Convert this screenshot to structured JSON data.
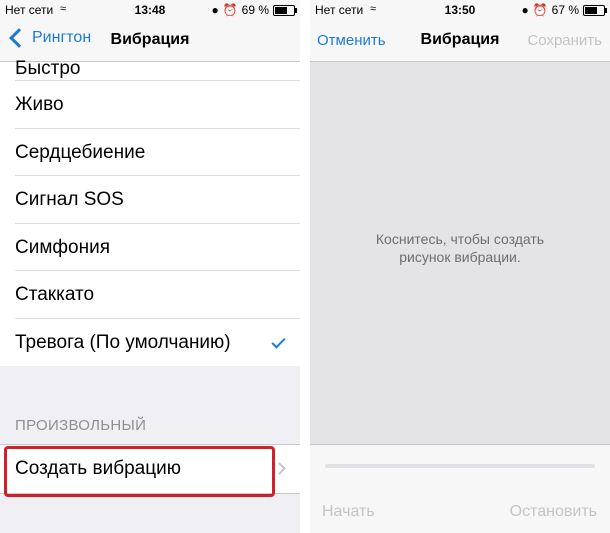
{
  "left_screen": {
    "status": {
      "carrier": "Нет сети",
      "time": "13:48",
      "battery": "69 %",
      "battery_level": 0.69
    },
    "nav": {
      "back_label": "Рингтон",
      "title": "Вибрация"
    },
    "items": [
      {
        "label": "Быстро",
        "checked": false
      },
      {
        "label": "Живо",
        "checked": false
      },
      {
        "label": "Сердцебиение",
        "checked": false
      },
      {
        "label": "Сигнал SOS",
        "checked": false
      },
      {
        "label": "Симфония",
        "checked": false
      },
      {
        "label": "Стаккато",
        "checked": false
      },
      {
        "label": "Тревога (По умолчанию)",
        "checked": true
      }
    ],
    "custom_section": {
      "header": "ПРОИЗВОЛЬНЫЙ",
      "create_label": "Создать вибрацию"
    }
  },
  "right_screen": {
    "status": {
      "carrier": "Нет сети",
      "time": "13:50",
      "battery": "67 %",
      "battery_level": 0.67
    },
    "nav": {
      "cancel_label": "Отменить",
      "title": "Вибрация",
      "save_label": "Сохранить"
    },
    "hint_line1": "Коснитесь, чтобы создать",
    "hint_line2": "рисунок вибрации.",
    "bottom": {
      "start_label": "Начать",
      "stop_label": "Остановить"
    }
  },
  "colors": {
    "accent": "#1a7bd6",
    "highlight": "#d0202a",
    "disabled": "#c4c4c8"
  }
}
